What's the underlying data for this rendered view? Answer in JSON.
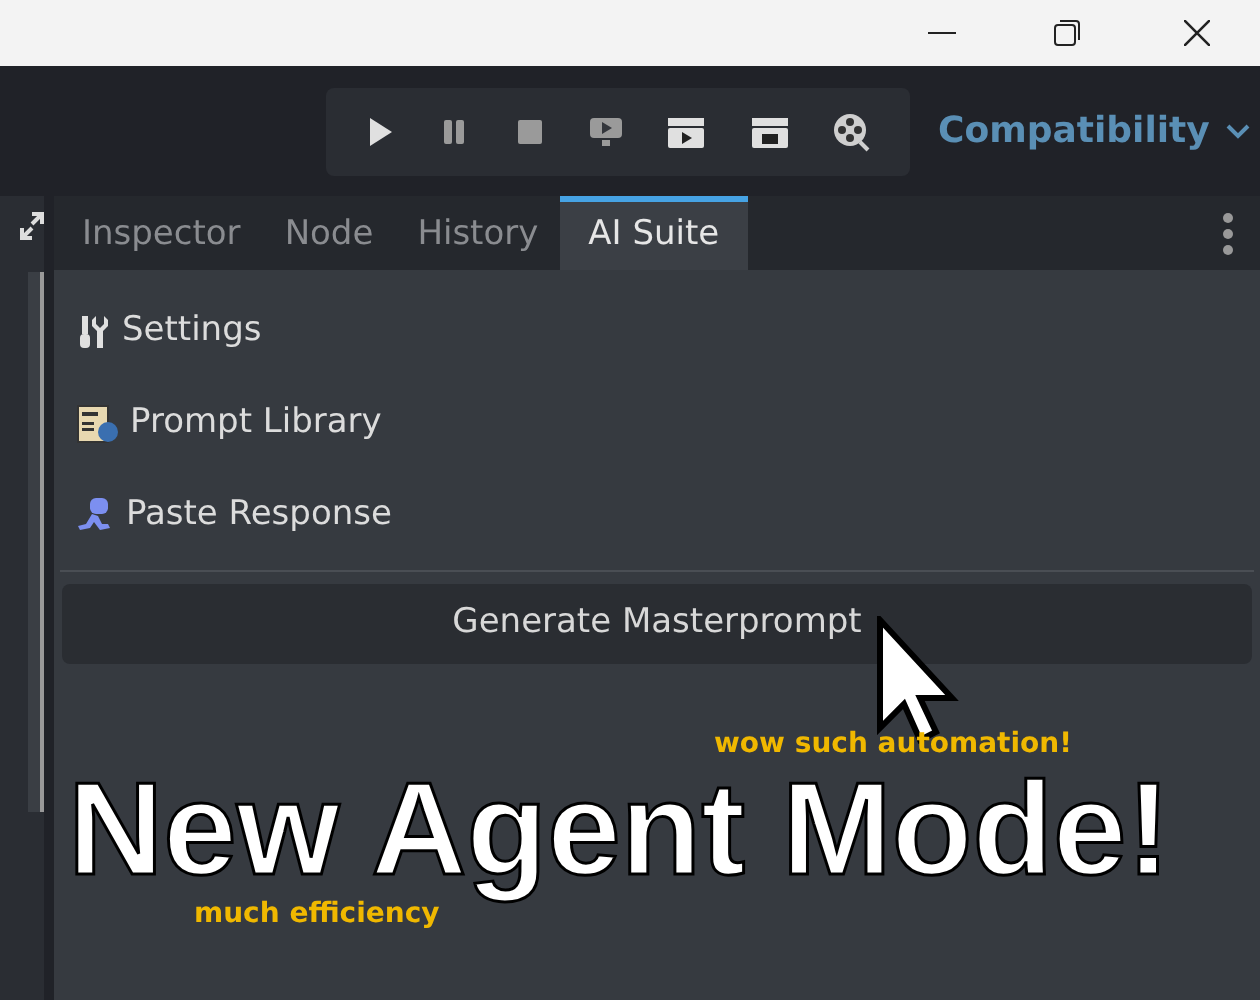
{
  "toolbar": {
    "buttons": [
      {
        "kind": "play"
      },
      {
        "kind": "pause"
      },
      {
        "kind": "stop"
      },
      {
        "kind": "remote"
      },
      {
        "kind": "scene-play"
      },
      {
        "kind": "scene-custom"
      },
      {
        "kind": "movie"
      }
    ],
    "renderer": "Compatibility"
  },
  "tabs": [
    {
      "label": "Inspector",
      "selected": false
    },
    {
      "label": "Node",
      "selected": false
    },
    {
      "label": "History",
      "selected": false
    },
    {
      "label": "AI Suite",
      "selected": true
    }
  ],
  "menu_items": [
    {
      "kind": "settings",
      "label": "Settings"
    },
    {
      "kind": "library",
      "label": "Prompt Library"
    },
    {
      "kind": "paste",
      "label": "Paste Response"
    }
  ],
  "generate_button": "Generate Masterprompt",
  "overlay": {
    "headline": "New Agent Mode!",
    "caption_top": "wow such automation!",
    "caption_bottom": "much efficiency"
  }
}
